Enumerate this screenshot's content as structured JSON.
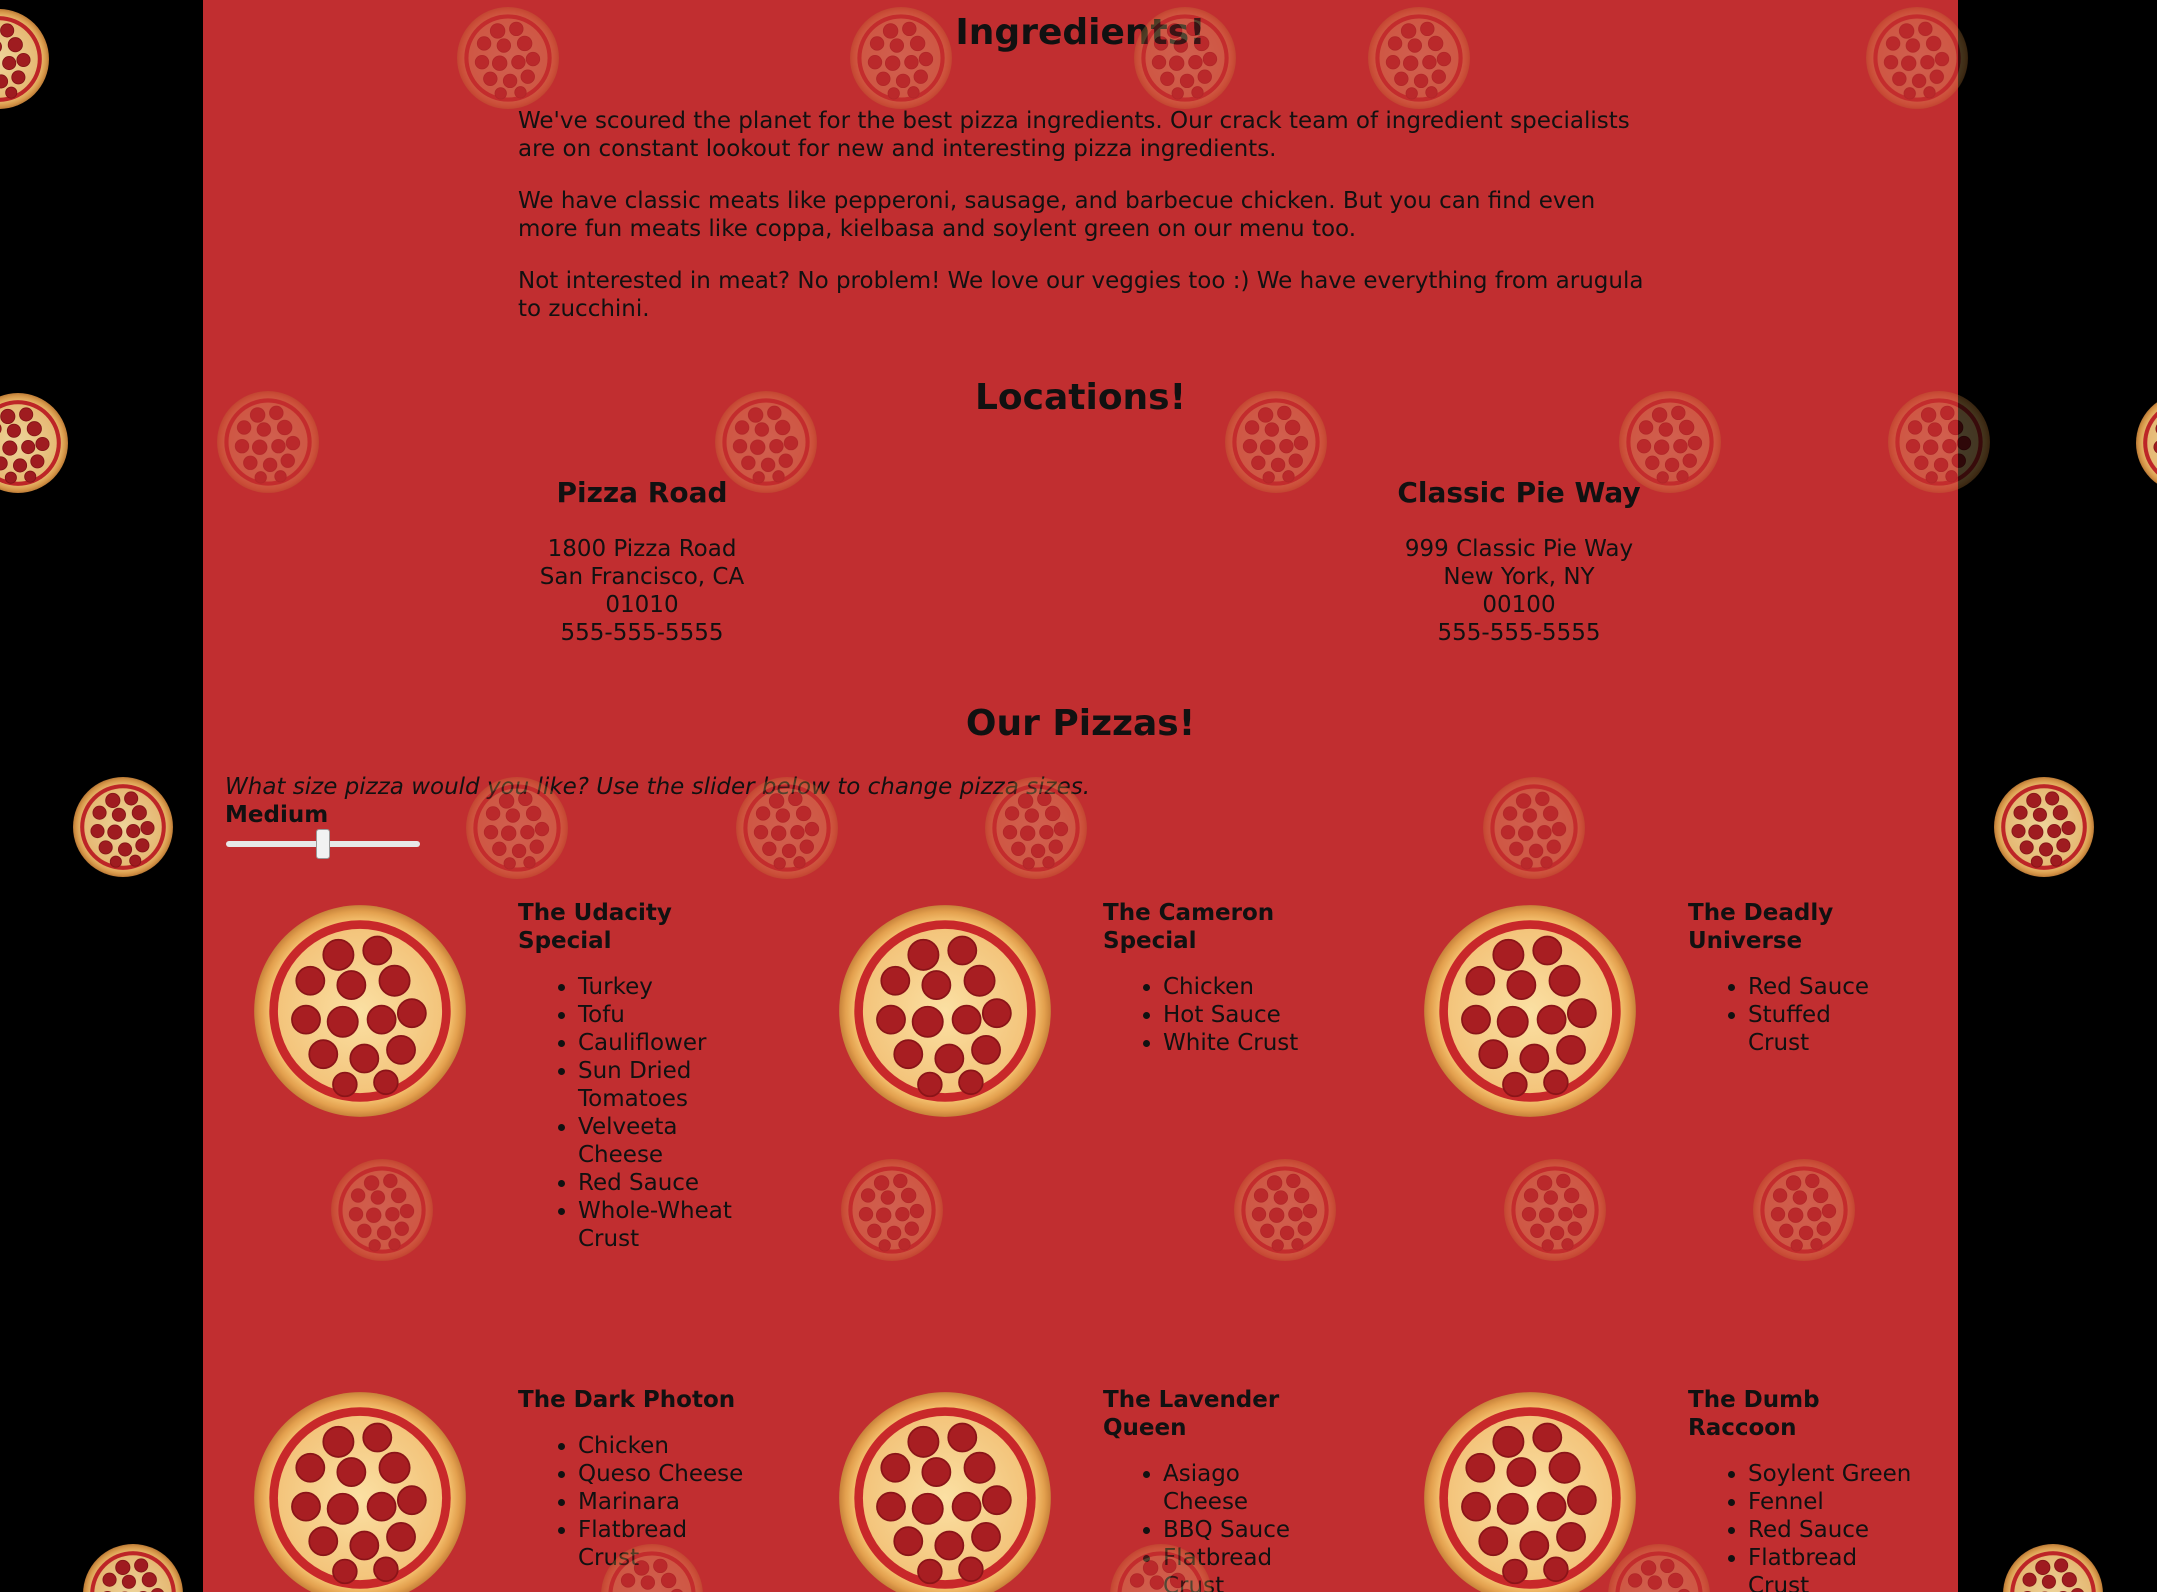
{
  "ingredients": {
    "title": "Ingredients!",
    "paragraphs": [
      "We've scoured the planet for the best pizza ingredients. Our crack team of ingredient specialists are on constant lookout for new and interesting pizza ingredients.",
      "We have classic meats like pepperoni, sausage, and barbecue chicken. But you can find even more fun meats like coppa, kielbasa and soylent green on our menu too.",
      "Not interested in meat? No problem! We love our veggies too :) We have everything from arugula to zucchini."
    ]
  },
  "locations": {
    "title": "Locations!",
    "items": [
      {
        "name": "Pizza Road",
        "street": "1800 Pizza Road",
        "city": "San Francisco, CA",
        "zip": "01010",
        "phone": "555-555-5555"
      },
      {
        "name": "Classic Pie Way",
        "street": "999 Classic Pie Way",
        "city": "New York, NY",
        "zip": "00100",
        "phone": "555-555-5555"
      }
    ]
  },
  "pizzas": {
    "title": "Our Pizzas!",
    "prompt": "What size pizza would you like? Use the slider below to change pizza sizes.",
    "size_label": "Medium",
    "slider_value": 0.5,
    "items": [
      {
        "name": "The Udacity Special",
        "ingredients": [
          "Turkey",
          "Tofu",
          "Cauliflower",
          "Sun Dried Tomatoes",
          "Velveeta Cheese",
          "Red Sauce",
          "Whole-Wheat Crust"
        ]
      },
      {
        "name": "The Cameron Special",
        "ingredients": [
          "Chicken",
          "Hot Sauce",
          "White Crust"
        ]
      },
      {
        "name": "The Deadly Universe",
        "ingredients": [
          "Red Sauce",
          "Stuffed Crust"
        ]
      },
      {
        "name": "The Dark Photon",
        "ingredients": [
          "Chicken",
          "Queso Cheese",
          "Marinara",
          "Flatbread Crust"
        ]
      },
      {
        "name": "The Lavender Queen",
        "ingredients": [
          "Asiago Cheese",
          "BBQ Sauce",
          "Flatbread Crust"
        ]
      },
      {
        "name": "The Dumb Raccoon",
        "ingredients": [
          "Soylent Green",
          "Fennel",
          "Red Sauce",
          "Flatbread Crust"
        ]
      }
    ]
  },
  "colors": {
    "page_background": "#c12e30",
    "body_background": "#000000",
    "pizza_crust": "#e8b060",
    "pizza_sauce": "#c8282a",
    "pizza_cheese": "#f7cf8a",
    "pepperoni": "#a81e22"
  },
  "icons": {
    "pizza": "pizza-icon",
    "background_pizza": "sliding-pizza-icon"
  }
}
